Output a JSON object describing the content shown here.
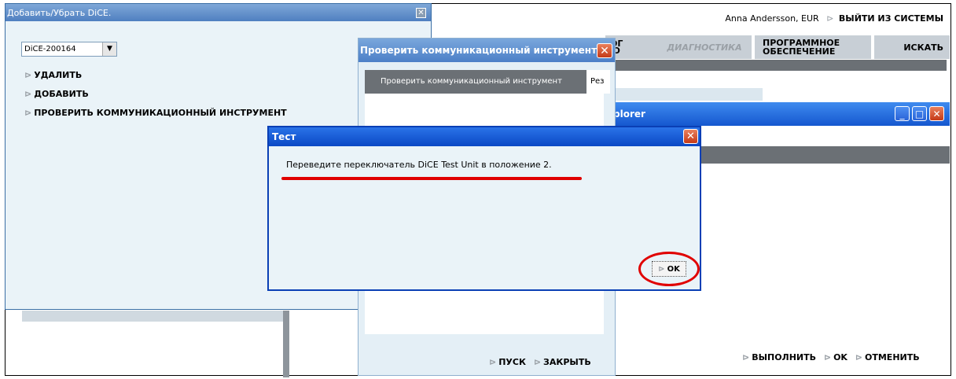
{
  "header": {
    "user": "Anna Andersson, EUR",
    "logout": "ВЫЙТИ ИЗ СИСТЕМЫ",
    "tabs": {
      "partial": "ОГ\nО",
      "diagnostics": "ДИАГНОСТИКА",
      "software_line1": "ПРОГРАММНОЕ",
      "software_line2": "ОБЕСПЕЧЕНИЕ",
      "search": "ИСКАТЬ"
    }
  },
  "explorer": {
    "title": "plorer",
    "actions": {
      "run": "ВЫПОЛНИТЬ",
      "ok": "OK",
      "cancel": "ОТМЕНИТЬ"
    }
  },
  "add_window": {
    "title": "Добавить/Убрать DiCE.",
    "selected_device": "DiCE-200164",
    "menu": [
      "УДАЛИТЬ",
      "ДОБАВИТЬ",
      "ПРОВЕРИТЬ КОММУНИКАЦИОННЫЙ ИНСТРУМЕНТ"
    ]
  },
  "check_window": {
    "title": "Проверить коммуникационный инструмент",
    "tab_active": "Проверить коммуникационный инструмент",
    "tab_partial": "Рез",
    "actions": {
      "start": "ПУСК",
      "close": "ЗАКРЫТЬ"
    }
  },
  "dialog": {
    "title": "Тест",
    "message": "Переведите переключатель DiCE Test Unit в положение 2.",
    "ok_label": "OK"
  }
}
